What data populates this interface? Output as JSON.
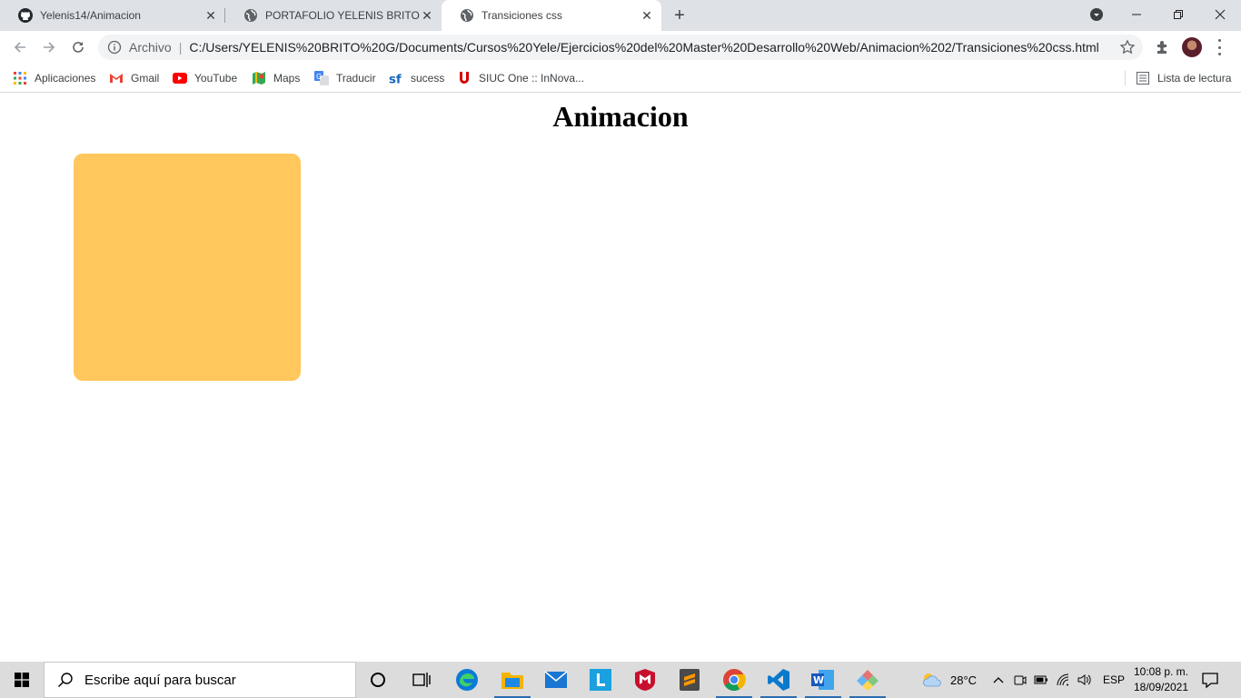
{
  "browser": {
    "tabs": [
      {
        "title": "Yelenis14/Animacion",
        "icon": "github-icon",
        "active": false
      },
      {
        "title": "PORTAFOLIO YELENIS BRITO GONZALEZ",
        "icon": "globe-icon",
        "active": false
      },
      {
        "title": "Transiciones css",
        "icon": "globe-icon",
        "active": true
      }
    ],
    "omnibox": {
      "scheme_label": "Archivo",
      "url": "C:/Users/YELENIS%20BRITO%20G/Documents/Cursos%20Yele/Ejercicios%20del%20Master%20Desarrollo%20Web/Animacion%202/Transiciones%20css.html"
    },
    "bookmarks": [
      {
        "label": "Aplicaciones",
        "icon": "apps-grid-icon"
      },
      {
        "label": "Gmail",
        "icon": "gmail-icon"
      },
      {
        "label": "YouTube",
        "icon": "youtube-icon"
      },
      {
        "label": "Maps",
        "icon": "maps-icon"
      },
      {
        "label": "Traducir",
        "icon": "translate-icon"
      },
      {
        "label": "sucess",
        "icon": "sf-icon"
      },
      {
        "label": "SIUC One :: InNova...",
        "icon": "siuc-icon"
      }
    ],
    "reading_list_label": "Lista de lectura"
  },
  "page": {
    "heading": "Animacion",
    "box_color": "#ffc75c"
  },
  "taskbar": {
    "search_placeholder": "Escribe aquí para buscar",
    "weather": "28°C",
    "language": "ESP",
    "time": "10:08 p. m.",
    "date": "18/09/2021"
  },
  "colors": {
    "tabstrip": "#dee1e6",
    "accent_blue": "#1a73e8",
    "taskbar": "#dcdcdc"
  }
}
